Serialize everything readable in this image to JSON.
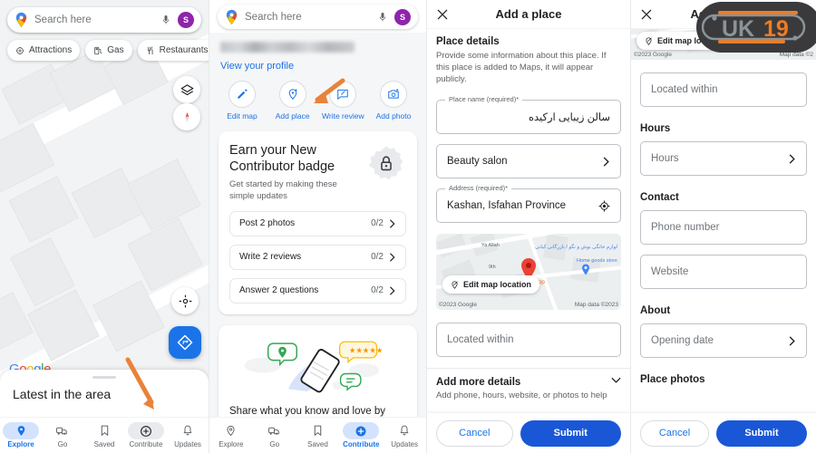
{
  "panel1": {
    "search": {
      "placeholder": "Search here",
      "mic_icon": "microphone-icon",
      "avatar_letter": "S"
    },
    "chips": [
      {
        "label": "Attractions",
        "icon": "attractions-icon"
      },
      {
        "label": "Gas",
        "icon": "gas-station-icon"
      },
      {
        "label": "Restaurants",
        "icon": "restaurant-icon"
      }
    ],
    "map_controls": [
      {
        "name": "layers-button",
        "icon": "layers-icon"
      },
      {
        "name": "compass-button",
        "icon": "compass-icon"
      },
      {
        "name": "my-location-button",
        "icon": "my-location-icon"
      },
      {
        "name": "directions-fab",
        "icon": "directions-icon"
      }
    ],
    "google_logo": "Google",
    "sheet_title": "Latest in the area",
    "nav": [
      {
        "label": "Explore",
        "icon": "place-pin-icon",
        "state": "active"
      },
      {
        "label": "Go",
        "icon": "commute-icon",
        "state": "default"
      },
      {
        "label": "Saved",
        "icon": "bookmark-icon",
        "state": "default"
      },
      {
        "label": "Contribute",
        "icon": "plus-circle-icon",
        "state": "hover"
      },
      {
        "label": "Updates",
        "icon": "bell-icon",
        "state": "default"
      }
    ]
  },
  "panel2": {
    "search": {
      "placeholder": "Search here",
      "mic_icon": "microphone-icon",
      "avatar_letter": "S"
    },
    "profile_name_blurred": "",
    "view_profile_link": "View your profile",
    "actions": [
      {
        "label": "Edit map",
        "icon": "pencil-icon"
      },
      {
        "label": "Add place",
        "icon": "add-place-icon"
      },
      {
        "label": "Write review",
        "icon": "review-icon"
      },
      {
        "label": "Add photo",
        "icon": "add-photo-icon"
      }
    ],
    "badge_card": {
      "title": "Earn your New Contributor badge",
      "subtitle": "Get started by making these simple updates",
      "seal_icon": "lock-badge-icon",
      "tasks": [
        {
          "label": "Post 2 photos",
          "count": "0/2"
        },
        {
          "label": "Write 2 reviews",
          "count": "0/2"
        },
        {
          "label": "Answer 2 questions",
          "count": "0/2"
        }
      ]
    },
    "illustration_card": {
      "text": "Share what you know and love by"
    },
    "nav": [
      {
        "label": "Explore",
        "icon": "place-pin-icon",
        "state": "default"
      },
      {
        "label": "Go",
        "icon": "commute-icon",
        "state": "default"
      },
      {
        "label": "Saved",
        "icon": "bookmark-icon",
        "state": "default"
      },
      {
        "label": "Contribute",
        "icon": "plus-circle-icon",
        "state": "active"
      },
      {
        "label": "Updates",
        "icon": "bell-icon",
        "state": "default"
      }
    ]
  },
  "panel3": {
    "title": "Add a place",
    "close_icon": "close-icon",
    "section_title": "Place details",
    "section_desc": "Provide some information about this place. If this place is added to Maps, it will appear publicly.",
    "place_name": {
      "label": "Place name (required)*",
      "value": "سالن زیبایی ارکیده"
    },
    "category": {
      "value": "Beauty salon",
      "chevron": "chevron-right-icon"
    },
    "address": {
      "label": "Address (required)*",
      "value": "Kashan, Isfahan Province",
      "icon": "target-location-icon"
    },
    "map": {
      "edit_label": "Edit map location",
      "edit_icon": "edit-location-icon",
      "attribution_left": "©2023 Google",
      "attribution_right": "Map data ©2023",
      "poi_labels": [
        "لوازم خانگی بوش و نگو / بازرگانی کیانی",
        "Home goods store",
        "ch Shop",
        "Ya Allah",
        "9th"
      ]
    },
    "located_within": {
      "placeholder": "Located within"
    },
    "more_details": {
      "title": "Add more details",
      "desc": "Add phone, hours, website, or photos to help",
      "chevron": "chevron-down-icon"
    },
    "cancel_label": "Cancel",
    "submit_label": "Submit"
  },
  "panel4": {
    "title": "Add a place",
    "close_icon": "close-icon",
    "map_edit_label": "Edit map location",
    "map_attr_left": "©2023 Google",
    "map_attr_right": "Map data ©2",
    "located_within": {
      "placeholder": "Located within"
    },
    "hours_section": "Hours",
    "hours_field": {
      "placeholder": "Hours",
      "chevron": "chevron-right-icon"
    },
    "contact_section": "Contact",
    "phone_field": {
      "placeholder": "Phone number"
    },
    "website_field": {
      "placeholder": "Website"
    },
    "about_section": "About",
    "opening_date_field": {
      "placeholder": "Opening date",
      "chevron": "chevron-right-icon"
    },
    "place_photos_section": "Place photos",
    "cancel_label": "Cancel",
    "submit_label": "Submit",
    "watermark": {
      "name": "site-watermark-logo",
      "text": "UK19"
    }
  },
  "colors": {
    "google_blue": "#1a73e8",
    "submit_blue": "#1a57d6",
    "active_pill": "#d3e3fd",
    "arrow_orange": "#e8833a",
    "map_bg": "#f1f3f4",
    "watermark_bg": "#3a3a3c",
    "watermark_orange": "#f07c22",
    "watermark_gray": "#8b9398"
  }
}
